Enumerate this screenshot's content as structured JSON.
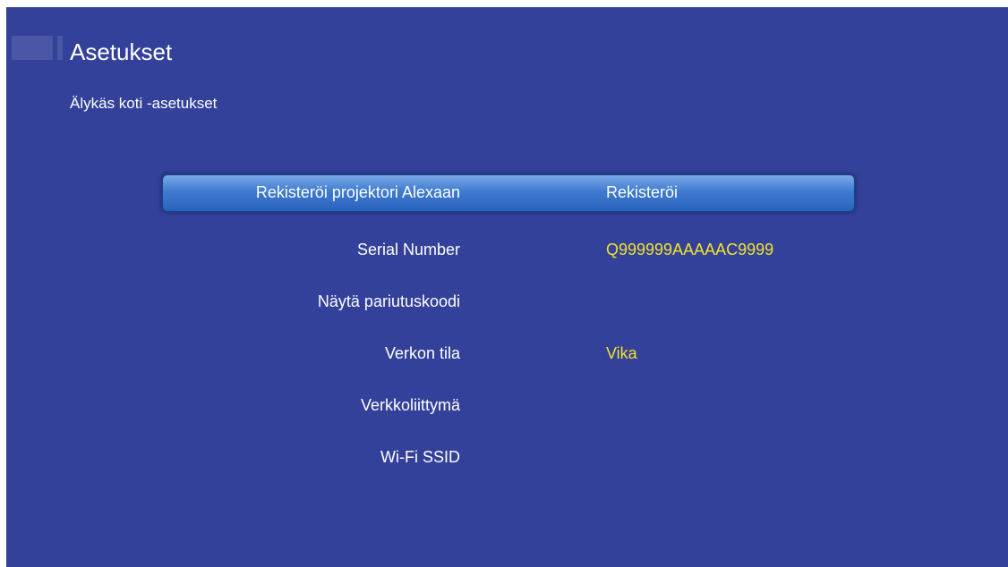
{
  "header": {
    "title": "Asetukset",
    "subtitle": "Älykäs koti -asetukset"
  },
  "settings": {
    "rows": [
      {
        "label": "Rekisteröi projektori Alexaan",
        "value": "Rekisteröi"
      },
      {
        "label": "Serial Number",
        "value": "Q999999AAAAAC9999"
      },
      {
        "label": "Näytä pariutuskoodi",
        "value": ""
      },
      {
        "label": "Verkon tila",
        "value": "Vika"
      },
      {
        "label": "Verkkoliittymä",
        "value": ""
      },
      {
        "label": "Wi-Fi SSID",
        "value": ""
      }
    ]
  },
  "colors": {
    "background": "#33419b",
    "highlight": "#3f7bd0",
    "value_accent": "#f2e32b"
  }
}
